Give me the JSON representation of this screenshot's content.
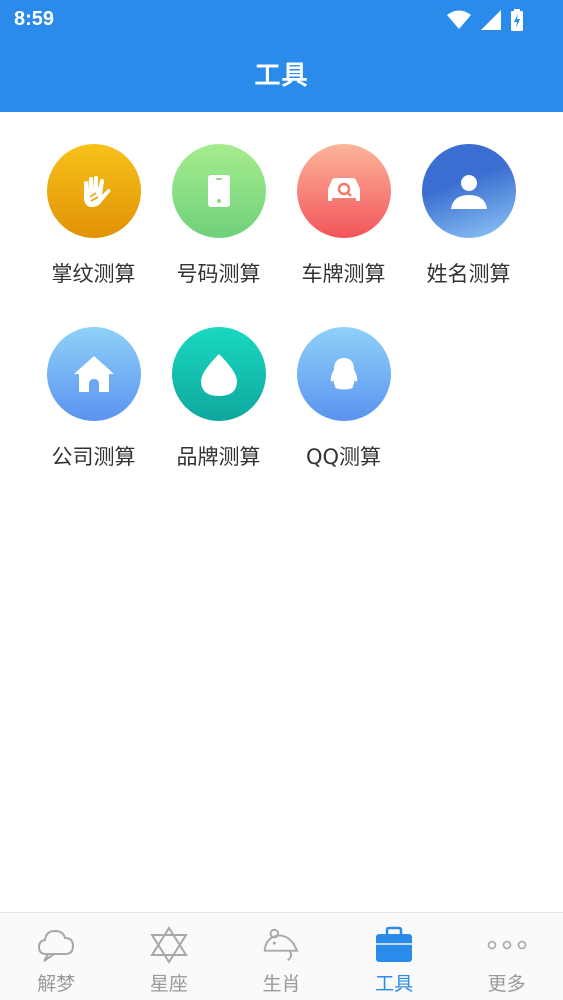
{
  "status": {
    "time": "8:59"
  },
  "header": {
    "title": "工具"
  },
  "tools": [
    {
      "label": "掌纹测算",
      "icon": "palm-icon",
      "color_from": "#f7c21a",
      "color_to": "#e29206"
    },
    {
      "label": "号码测算",
      "icon": "phone-icon",
      "color_from": "#a6ec8e",
      "color_to": "#6fd17a"
    },
    {
      "label": "车牌测算",
      "icon": "car-icon",
      "color_from": "#fbb59b",
      "color_to": "#f3545b"
    },
    {
      "label": "姓名测算",
      "icon": "person-icon",
      "color_from": "#3c6ed1",
      "color_to": "#8fc8f5"
    },
    {
      "label": "公司测算",
      "icon": "house-icon",
      "color_from": "#8fd1f9",
      "color_to": "#5b93f0"
    },
    {
      "label": "品牌测算",
      "icon": "drop-icon",
      "color_from": "#19d9c0",
      "color_to": "#0fa79f"
    },
    {
      "label": "QQ测算",
      "icon": "penguin-icon",
      "color_from": "#8fd1f9",
      "color_to": "#5b93f0"
    }
  ],
  "nav": [
    {
      "label": "解梦",
      "icon": "cloud-icon",
      "active": false
    },
    {
      "label": "星座",
      "icon": "star-of-david-icon",
      "active": false
    },
    {
      "label": "生肖",
      "icon": "mouse-icon",
      "active": false
    },
    {
      "label": "工具",
      "icon": "toolbox-icon",
      "active": true
    },
    {
      "label": "更多",
      "icon": "more-dots-icon",
      "active": false
    }
  ],
  "colors": {
    "primary": "#2b8bea",
    "nav_inactive": "#9a9a9a"
  }
}
